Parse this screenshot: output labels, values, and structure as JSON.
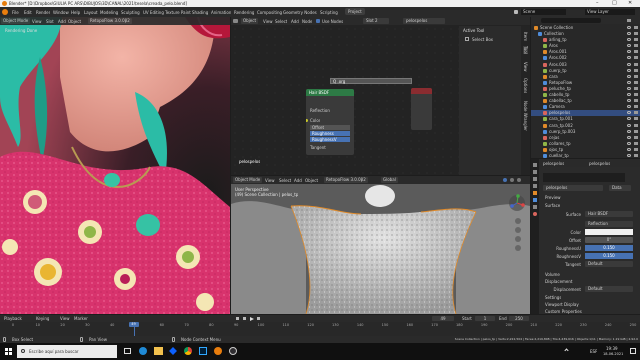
{
  "title_bar": {
    "text": "Blender* [D:\\Dropbox\\GIULIA PC ARS\\DIBUJOS\\3D\\CANAL\\2021\\tesela\\creada_pelo.blend]",
    "controls": [
      "–",
      "□",
      "✕"
    ]
  },
  "menu": {
    "items": [
      "File",
      "Edit",
      "Render",
      "Window",
      "Help"
    ]
  },
  "workspace_tabs": [
    "Layout",
    "Modeling",
    "Sculpting",
    "UV Editing",
    "Texture Paint",
    "Shading",
    "Animation",
    "Rendering",
    "Compositing",
    "Geometry Nodes",
    "Scripting",
    "Project"
  ],
  "active_workspace": "Project",
  "scene": {
    "name": "Scene",
    "view_layer": "View Layer"
  },
  "render_view": {
    "header": [
      "Object Mode",
      "View",
      "Slot",
      "Add",
      "Object",
      "RetopoFlow 3.0.0β2"
    ],
    "status": "Rendering Done"
  },
  "node_editor": {
    "header": [
      "Object",
      "View",
      "Select",
      "Add",
      "Node",
      "Use Nodes",
      "Slot 2",
      "pelospelos"
    ],
    "search_label": "Q .org",
    "node_title": "Hair BSDF",
    "node_fields": [
      "Reflection",
      "Color",
      "Offset",
      "Roughness",
      "RoughnessV",
      "Tangent"
    ],
    "object_label": "pelospelos",
    "panel_title": "Active Tool",
    "panel_item": "Select Box",
    "side_tabs": [
      "Item",
      "Tool",
      "View",
      "Options",
      "Node Wrangler"
    ]
  },
  "viewport": {
    "header": [
      "Object Mode",
      "View",
      "Select",
      "Add",
      "Object",
      "RetopoFlow 3.0.0β2"
    ],
    "header2": [
      "Global"
    ],
    "info_line1": "User Perspective",
    "info_line2": "(49) Scene Collection | pelos_tp"
  },
  "outliner": {
    "title": "Scene Collection",
    "items": [
      "Collection",
      "arling_tp",
      "Aros",
      "Aros.001",
      "Aros.002",
      "Aros.003",
      "cuerp_tp",
      "cara",
      "RetopoFlow",
      "peluche_tp",
      "cabello_tp",
      "cabellac_tp",
      "Camera",
      "pelospelos",
      "cara_tp.001",
      "cara_tp.002",
      "cuerp_tp.003",
      "cejas",
      "collares_tp",
      "ojos_tp",
      "cuellar_tp"
    ],
    "selected": "pelospelos"
  },
  "properties": {
    "object": "pelospelos",
    "material_slot": "pelospelos",
    "data_label": "Data",
    "sections": [
      "Preview",
      "Surface"
    ],
    "surface_label": "Surface",
    "surface_value": "Hair BSDF",
    "reflection": "Reflection",
    "color_label": "Color",
    "offset_label": "Offset",
    "offset_value": "0°",
    "roughnessu_label": "RoughnessU",
    "roughnessu_value": "0.150",
    "roughnessv_label": "RoughnessV",
    "roughnessv_value": "0.150",
    "tangent_label": "Tangent",
    "tangent_value": "Default",
    "bottom_sections": [
      "Volume",
      "Displacement",
      "Settings",
      "Viewport Display",
      "Custom Properties"
    ],
    "displacement_label": "Displacement",
    "displacement_value": "Default"
  },
  "timeline": {
    "header": [
      "Playback",
      "Keying",
      "View",
      "Marker"
    ],
    "frame_current": "49",
    "start_label": "Start",
    "start_value": "1",
    "end_label": "End",
    "end_value": "250",
    "ticks": [
      "0",
      "10",
      "20",
      "30",
      "40",
      "50",
      "60",
      "70",
      "80",
      "90",
      "100",
      "110",
      "120",
      "130",
      "140",
      "150",
      "160",
      "170",
      "180",
      "190",
      "200",
      "210",
      "220",
      "230",
      "240",
      "250"
    ]
  },
  "status_bar": {
    "left": "Box Select",
    "mid1": "Pan View",
    "mid2": "Node Context Menu",
    "right": "Scene Collection | pelos_tp | Verts:2,222,504 | Faces:2,219,808 | Tris:4,439,616 | Objects:1/11 | Memory: 1.19 GiB | 2.92.0"
  },
  "taskbar": {
    "search_placeholder": "Escribe aquí para buscar",
    "lang": "ESP",
    "time": "19:39",
    "date": "18-06-2021"
  },
  "colors": {
    "accent": "#e08a29",
    "hair": "#2ec2a8",
    "blouse": "#e0417b",
    "blender_blue": "#4772b3",
    "node_green": "#2d7a45"
  }
}
